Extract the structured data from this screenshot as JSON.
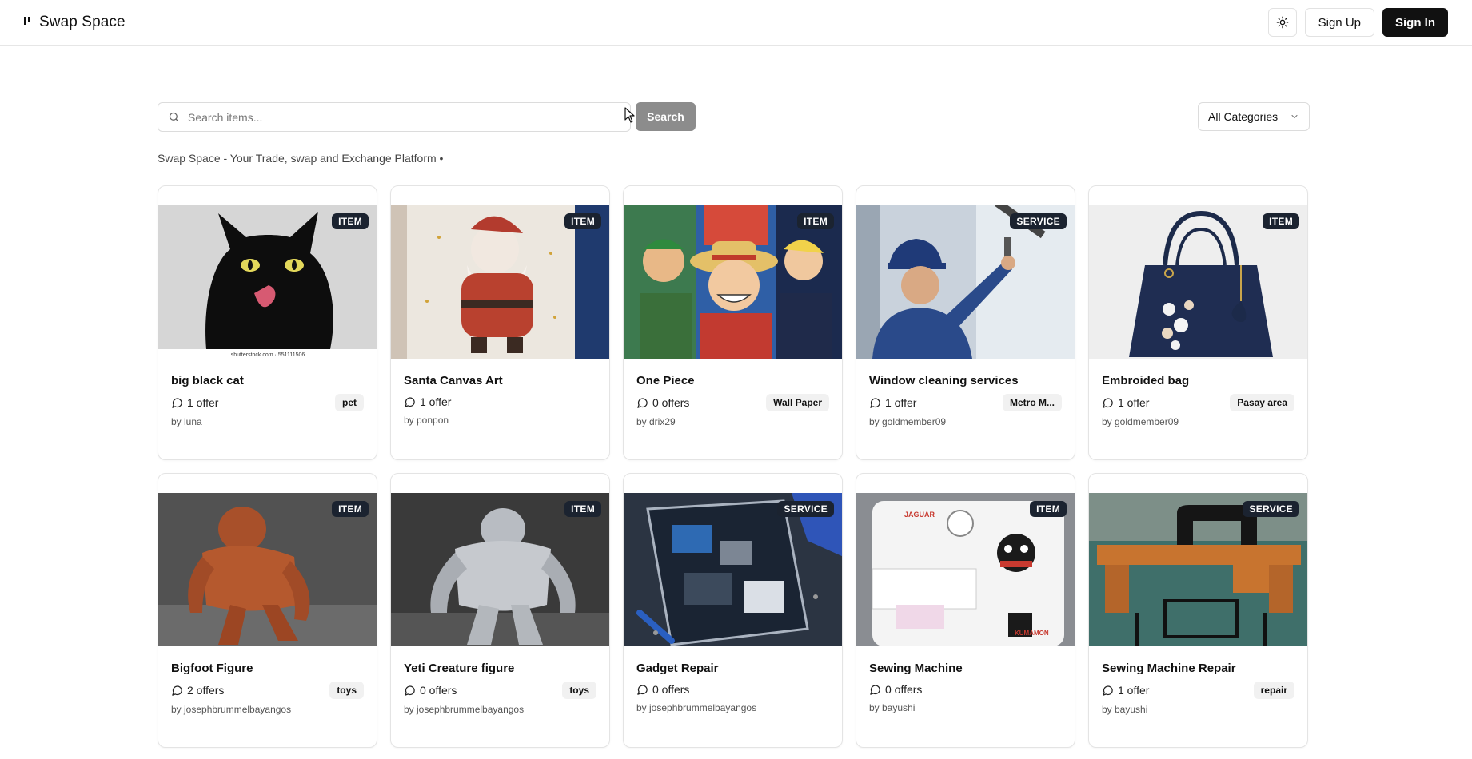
{
  "header": {
    "brand": "Swap Space",
    "sign_up": "Sign Up",
    "sign_in": "Sign In",
    "theme_icon": "sun-icon"
  },
  "search": {
    "placeholder": "Search items...",
    "value": "",
    "button": "Search"
  },
  "category_filter": {
    "selected": "All Categories"
  },
  "tagline": "Swap Space - Your Trade, swap and Exchange Platform •",
  "colors": {
    "badge_bg": "#1b2330",
    "primary_dark": "#111111",
    "search_button": "#8c8c8c",
    "tag_bg": "#f1f1f1"
  },
  "listings": [
    {
      "type": "ITEM",
      "title": "big black cat",
      "offers": "1 offer",
      "category": "pet",
      "owner": "by luna",
      "image_caption": "shutterstock.com · 551111506"
    },
    {
      "type": "ITEM",
      "title": "Santa Canvas Art",
      "offers": "1 offer",
      "category": "",
      "owner": "by ponpon"
    },
    {
      "type": "ITEM",
      "title": "One Piece",
      "offers": "0 offers",
      "category": "Wall Paper",
      "owner": "by drix29"
    },
    {
      "type": "SERVICE",
      "title": "Window cleaning services",
      "offers": "1 offer",
      "category": "Metro M...",
      "owner": "by goldmember09"
    },
    {
      "type": "ITEM",
      "title": "Embroided bag",
      "offers": "1 offer",
      "category": "Pasay area",
      "owner": "by goldmember09"
    },
    {
      "type": "ITEM",
      "title": "Bigfoot Figure",
      "offers": "2 offers",
      "category": "toys",
      "owner": "by josephbrummelbayangos"
    },
    {
      "type": "ITEM",
      "title": "Yeti Creature figure",
      "offers": "0 offers",
      "category": "toys",
      "owner": "by josephbrummelbayangos"
    },
    {
      "type": "SERVICE",
      "title": "Gadget Repair",
      "offers": "0 offers",
      "category": "",
      "owner": "by josephbrummelbayangos"
    },
    {
      "type": "ITEM",
      "title": "Sewing Machine",
      "offers": "0 offers",
      "category": "",
      "owner": "by bayushi"
    },
    {
      "type": "SERVICE",
      "title": "Sewing Machine Repair",
      "offers": "1 offer",
      "category": "repair",
      "owner": "by bayushi"
    }
  ]
}
